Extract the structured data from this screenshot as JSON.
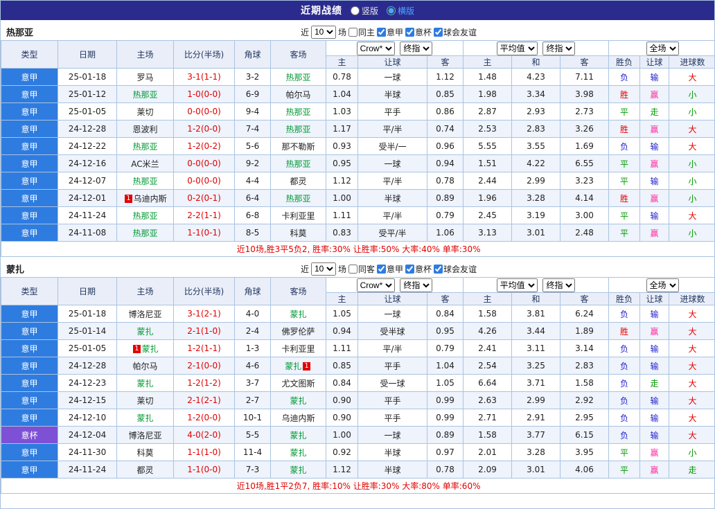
{
  "topbar": {
    "title": "近期战绩",
    "layout_vertical": "竖版",
    "layout_horizontal": "横版"
  },
  "controls": {
    "near": "近",
    "count": "10",
    "games": "场",
    "serie_a": "意甲",
    "coppa": "意杯",
    "friendly": "球会友谊"
  },
  "table_header": {
    "type": "类型",
    "date": "日期",
    "home": "主场",
    "score": "比分(半场)",
    "corner": "角球",
    "away": "客场",
    "select_crow": "Crow*",
    "select_final": "终指",
    "select_avg": "平均值",
    "select_fulltime": "全场",
    "sub": [
      "主",
      "让球",
      "客",
      "主",
      "和",
      "客",
      "胜负",
      "让球",
      "进球数"
    ]
  },
  "misc": {
    "redcard": "1"
  },
  "colors": {
    "red": "#e10000",
    "green": "#009900",
    "blue": "#2121cd",
    "pink": "#ff2da0",
    "dark": "#1f1f1f",
    "team": "#009933",
    "score": "#e10000",
    "league_blue": "#2e7ce0",
    "league_purple": "#7d50d5"
  },
  "sections": [
    {
      "team": "热那亚",
      "same_label": "同主",
      "summary": "近10场,胜3平5负2, 胜率:30% 让胜率:50% 大率:40% 单率:30%",
      "rows": [
        {
          "league": [
            "意甲",
            "league_blue"
          ],
          "date": "25-01-18",
          "home": {
            "name": "罗马",
            "hl": false,
            "rc": ""
          },
          "score": "3-1(1-1)",
          "corner": "3-2",
          "away": {
            "name": "热那亚",
            "hl": true,
            "rc": ""
          },
          "odds": [
            "0.78",
            "一球",
            "1.12",
            "1.48",
            "4.23",
            "7.11"
          ],
          "results": [
            [
              "负",
              "blue"
            ],
            [
              "输",
              "blue"
            ],
            [
              "大",
              "red"
            ]
          ]
        },
        {
          "league": [
            "意甲",
            "league_blue"
          ],
          "date": "25-01-12",
          "home": {
            "name": "热那亚",
            "hl": true,
            "rc": ""
          },
          "score": "1-0(0-0)",
          "corner": "6-9",
          "away": {
            "name": "帕尔马",
            "hl": false,
            "rc": ""
          },
          "odds": [
            "1.04",
            "半球",
            "0.85",
            "1.98",
            "3.34",
            "3.98"
          ],
          "results": [
            [
              "胜",
              "red"
            ],
            [
              "赢",
              "pink"
            ],
            [
              "小",
              "green"
            ]
          ]
        },
        {
          "league": [
            "意甲",
            "league_blue"
          ],
          "date": "25-01-05",
          "home": {
            "name": "莱切",
            "hl": false,
            "rc": ""
          },
          "score": "0-0(0-0)",
          "corner": "9-4",
          "away": {
            "name": "热那亚",
            "hl": true,
            "rc": ""
          },
          "odds": [
            "1.03",
            "平手",
            "0.86",
            "2.87",
            "2.93",
            "2.73"
          ],
          "results": [
            [
              "平",
              "green"
            ],
            [
              "走",
              "green"
            ],
            [
              "小",
              "green"
            ]
          ]
        },
        {
          "league": [
            "意甲",
            "league_blue"
          ],
          "date": "24-12-28",
          "home": {
            "name": "恩波利",
            "hl": false,
            "rc": ""
          },
          "score": "1-2(0-0)",
          "corner": "7-4",
          "away": {
            "name": "热那亚",
            "hl": true,
            "rc": ""
          },
          "odds": [
            "1.17",
            "平/半",
            "0.74",
            "2.53",
            "2.83",
            "3.26"
          ],
          "results": [
            [
              "胜",
              "red"
            ],
            [
              "赢",
              "pink"
            ],
            [
              "大",
              "red"
            ]
          ]
        },
        {
          "league": [
            "意甲",
            "league_blue"
          ],
          "date": "24-12-22",
          "home": {
            "name": "热那亚",
            "hl": true,
            "rc": ""
          },
          "score": "1-2(0-2)",
          "corner": "5-6",
          "away": {
            "name": "那不勒斯",
            "hl": false,
            "rc": ""
          },
          "odds": [
            "0.93",
            "受半/一",
            "0.96",
            "5.55",
            "3.55",
            "1.69"
          ],
          "results": [
            [
              "负",
              "blue"
            ],
            [
              "输",
              "blue"
            ],
            [
              "大",
              "red"
            ]
          ]
        },
        {
          "league": [
            "意甲",
            "league_blue"
          ],
          "date": "24-12-16",
          "home": {
            "name": "AC米兰",
            "hl": false,
            "rc": ""
          },
          "score": "0-0(0-0)",
          "corner": "9-2",
          "away": {
            "name": "热那亚",
            "hl": true,
            "rc": ""
          },
          "odds": [
            "0.95",
            "一球",
            "0.94",
            "1.51",
            "4.22",
            "6.55"
          ],
          "results": [
            [
              "平",
              "green"
            ],
            [
              "赢",
              "pink"
            ],
            [
              "小",
              "green"
            ]
          ]
        },
        {
          "league": [
            "意甲",
            "league_blue"
          ],
          "date": "24-12-07",
          "home": {
            "name": "热那亚",
            "hl": true,
            "rc": ""
          },
          "score": "0-0(0-0)",
          "corner": "4-4",
          "away": {
            "name": "都灵",
            "hl": false,
            "rc": ""
          },
          "odds": [
            "1.12",
            "平/半",
            "0.78",
            "2.44",
            "2.99",
            "3.23"
          ],
          "results": [
            [
              "平",
              "green"
            ],
            [
              "输",
              "blue"
            ],
            [
              "小",
              "green"
            ]
          ]
        },
        {
          "league": [
            "意甲",
            "league_blue"
          ],
          "date": "24-12-01",
          "home": {
            "name": "乌迪内斯",
            "hl": false,
            "rc": "pre"
          },
          "score": "0-2(0-1)",
          "corner": "6-4",
          "away": {
            "name": "热那亚",
            "hl": true,
            "rc": ""
          },
          "odds": [
            "1.00",
            "半球",
            "0.89",
            "1.96",
            "3.28",
            "4.14"
          ],
          "results": [
            [
              "胜",
              "red"
            ],
            [
              "赢",
              "pink"
            ],
            [
              "小",
              "green"
            ]
          ]
        },
        {
          "league": [
            "意甲",
            "league_blue"
          ],
          "date": "24-11-24",
          "home": {
            "name": "热那亚",
            "hl": true,
            "rc": ""
          },
          "score": "2-2(1-1)",
          "corner": "6-8",
          "away": {
            "name": "卡利亚里",
            "hl": false,
            "rc": ""
          },
          "odds": [
            "1.11",
            "平/半",
            "0.79",
            "2.45",
            "3.19",
            "3.00"
          ],
          "results": [
            [
              "平",
              "green"
            ],
            [
              "输",
              "blue"
            ],
            [
              "大",
              "red"
            ]
          ]
        },
        {
          "league": [
            "意甲",
            "league_blue"
          ],
          "date": "24-11-08",
          "home": {
            "name": "热那亚",
            "hl": true,
            "rc": ""
          },
          "score": "1-1(0-1)",
          "corner": "8-5",
          "away": {
            "name": "科莫",
            "hl": false,
            "rc": ""
          },
          "odds": [
            "0.83",
            "受平/半",
            "1.06",
            "3.13",
            "3.01",
            "2.48"
          ],
          "results": [
            [
              "平",
              "green"
            ],
            [
              "赢",
              "pink"
            ],
            [
              "小",
              "green"
            ]
          ]
        }
      ]
    },
    {
      "team": "蒙扎",
      "same_label": "同客",
      "summary": "近10场,胜1平2负7, 胜率:10% 让胜率:30% 大率:80% 单率:60%",
      "rows": [
        {
          "league": [
            "意甲",
            "league_blue"
          ],
          "date": "25-01-18",
          "home": {
            "name": "博洛尼亚",
            "hl": false,
            "rc": ""
          },
          "score": "3-1(2-1)",
          "corner": "4-0",
          "away": {
            "name": "蒙扎",
            "hl": true,
            "rc": ""
          },
          "odds": [
            "1.05",
            "一球",
            "0.84",
            "1.58",
            "3.81",
            "6.24"
          ],
          "results": [
            [
              "负",
              "blue"
            ],
            [
              "输",
              "blue"
            ],
            [
              "大",
              "red"
            ]
          ]
        },
        {
          "league": [
            "意甲",
            "league_blue"
          ],
          "date": "25-01-14",
          "home": {
            "name": "蒙扎",
            "hl": true,
            "rc": ""
          },
          "score": "2-1(1-0)",
          "corner": "2-4",
          "away": {
            "name": "佛罗伦萨",
            "hl": false,
            "rc": ""
          },
          "odds": [
            "0.94",
            "受半球",
            "0.95",
            "4.26",
            "3.44",
            "1.89"
          ],
          "results": [
            [
              "胜",
              "red"
            ],
            [
              "赢",
              "pink"
            ],
            [
              "大",
              "red"
            ]
          ]
        },
        {
          "league": [
            "意甲",
            "league_blue"
          ],
          "date": "25-01-05",
          "home": {
            "name": "蒙扎",
            "hl": true,
            "rc": "pre"
          },
          "score": "1-2(1-1)",
          "corner": "1-3",
          "away": {
            "name": "卡利亚里",
            "hl": false,
            "rc": ""
          },
          "odds": [
            "1.11",
            "平/半",
            "0.79",
            "2.41",
            "3.11",
            "3.14"
          ],
          "results": [
            [
              "负",
              "blue"
            ],
            [
              "输",
              "blue"
            ],
            [
              "大",
              "red"
            ]
          ]
        },
        {
          "league": [
            "意甲",
            "league_blue"
          ],
          "date": "24-12-28",
          "home": {
            "name": "帕尔马",
            "hl": false,
            "rc": ""
          },
          "score": "2-1(0-0)",
          "corner": "4-6",
          "away": {
            "name": "蒙扎",
            "hl": true,
            "rc": "post"
          },
          "odds": [
            "0.85",
            "平手",
            "1.04",
            "2.54",
            "3.25",
            "2.83"
          ],
          "results": [
            [
              "负",
              "blue"
            ],
            [
              "输",
              "blue"
            ],
            [
              "大",
              "red"
            ]
          ]
        },
        {
          "league": [
            "意甲",
            "league_blue"
          ],
          "date": "24-12-23",
          "home": {
            "name": "蒙扎",
            "hl": true,
            "rc": ""
          },
          "score": "1-2(1-2)",
          "corner": "3-7",
          "away": {
            "name": "尤文图斯",
            "hl": false,
            "rc": ""
          },
          "odds": [
            "0.84",
            "受一球",
            "1.05",
            "6.64",
            "3.71",
            "1.58"
          ],
          "results": [
            [
              "负",
              "blue"
            ],
            [
              "走",
              "green"
            ],
            [
              "大",
              "red"
            ]
          ]
        },
        {
          "league": [
            "意甲",
            "league_blue"
          ],
          "date": "24-12-15",
          "home": {
            "name": "莱切",
            "hl": false,
            "rc": ""
          },
          "score": "2-1(2-1)",
          "corner": "2-7",
          "away": {
            "name": "蒙扎",
            "hl": true,
            "rc": ""
          },
          "odds": [
            "0.90",
            "平手",
            "0.99",
            "2.63",
            "2.99",
            "2.92"
          ],
          "results": [
            [
              "负",
              "blue"
            ],
            [
              "输",
              "blue"
            ],
            [
              "大",
              "red"
            ]
          ]
        },
        {
          "league": [
            "意甲",
            "league_blue"
          ],
          "date": "24-12-10",
          "home": {
            "name": "蒙扎",
            "hl": true,
            "rc": ""
          },
          "score": "1-2(0-0)",
          "corner": "10-1",
          "away": {
            "name": "乌迪内斯",
            "hl": false,
            "rc": ""
          },
          "odds": [
            "0.90",
            "平手",
            "0.99",
            "2.71",
            "2.91",
            "2.95"
          ],
          "results": [
            [
              "负",
              "blue"
            ],
            [
              "输",
              "blue"
            ],
            [
              "大",
              "red"
            ]
          ]
        },
        {
          "league": [
            "意杯",
            "league_purple"
          ],
          "date": "24-12-04",
          "home": {
            "name": "博洛尼亚",
            "hl": false,
            "rc": ""
          },
          "score": "4-0(2-0)",
          "corner": "5-5",
          "away": {
            "name": "蒙扎",
            "hl": true,
            "rc": ""
          },
          "odds": [
            "1.00",
            "一球",
            "0.89",
            "1.58",
            "3.77",
            "6.15"
          ],
          "results": [
            [
              "负",
              "blue"
            ],
            [
              "输",
              "blue"
            ],
            [
              "大",
              "red"
            ]
          ]
        },
        {
          "league": [
            "意甲",
            "league_blue"
          ],
          "date": "24-11-30",
          "home": {
            "name": "科莫",
            "hl": false,
            "rc": ""
          },
          "score": "1-1(1-0)",
          "corner": "11-4",
          "away": {
            "name": "蒙扎",
            "hl": true,
            "rc": ""
          },
          "odds": [
            "0.92",
            "半球",
            "0.97",
            "2.01",
            "3.28",
            "3.95"
          ],
          "results": [
            [
              "平",
              "green"
            ],
            [
              "赢",
              "pink"
            ],
            [
              "小",
              "green"
            ]
          ]
        },
        {
          "league": [
            "意甲",
            "league_blue"
          ],
          "date": "24-11-24",
          "home": {
            "name": "都灵",
            "hl": false,
            "rc": ""
          },
          "score": "1-1(0-0)",
          "corner": "7-3",
          "away": {
            "name": "蒙扎",
            "hl": true,
            "rc": ""
          },
          "odds": [
            "1.12",
            "半球",
            "0.78",
            "2.09",
            "3.01",
            "4.06"
          ],
          "results": [
            [
              "平",
              "green"
            ],
            [
              "赢",
              "pink"
            ],
            [
              "走",
              "green"
            ]
          ]
        }
      ]
    }
  ]
}
